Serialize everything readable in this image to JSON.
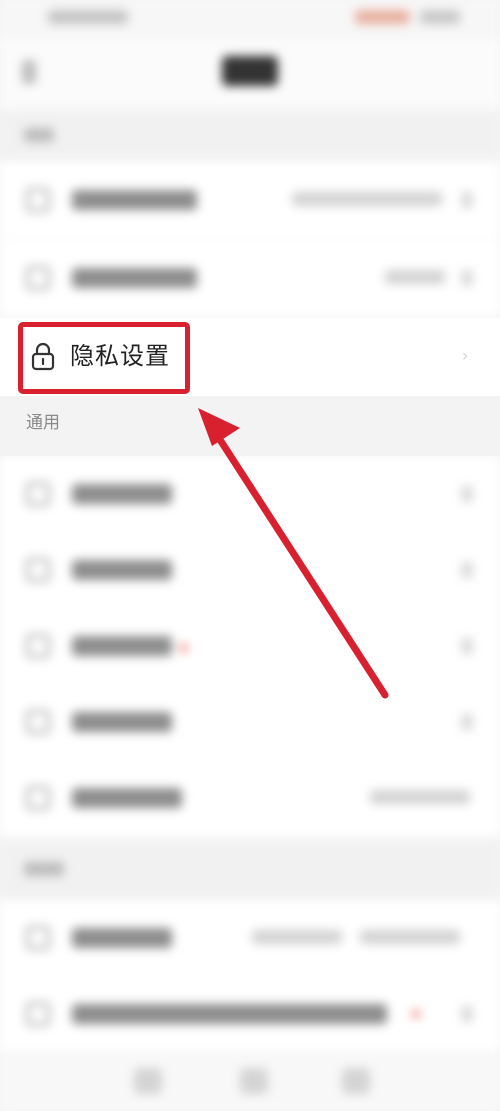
{
  "privacy": {
    "label": "隐私设置",
    "icon": "lock-icon"
  },
  "sections": {
    "general": "通用"
  },
  "annotation": {
    "highlight_color": "#d8202e"
  }
}
